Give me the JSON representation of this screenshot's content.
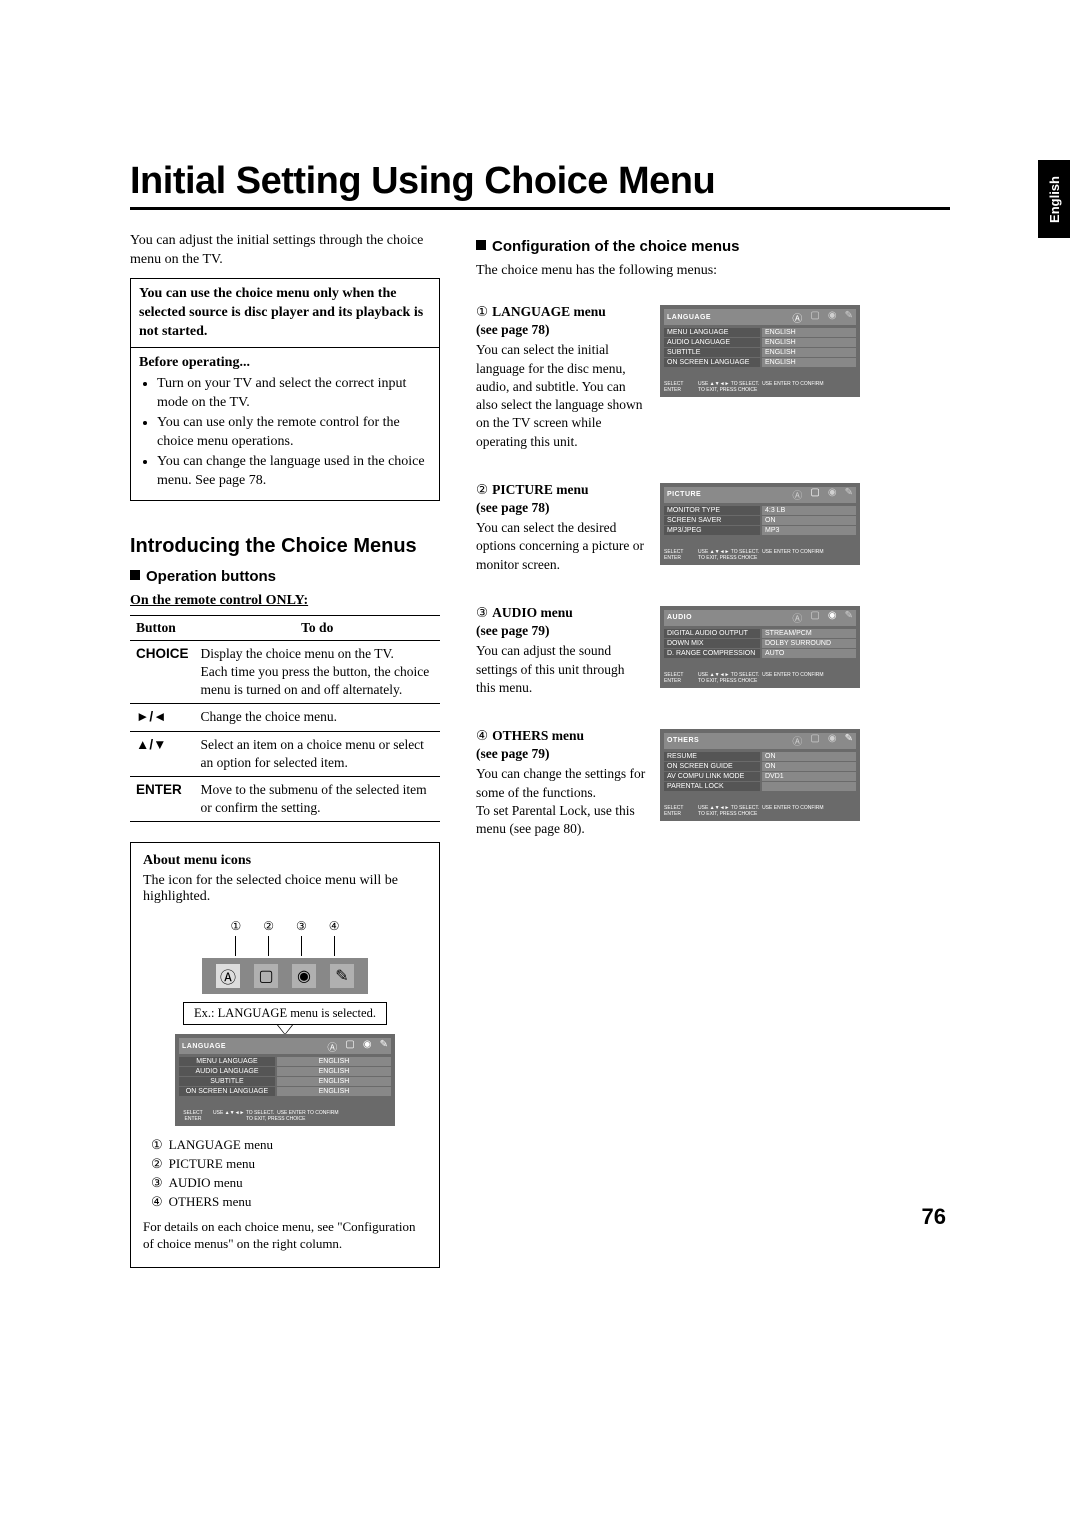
{
  "language_tab": "English",
  "title": "Initial Setting Using Choice Menu",
  "intro": "You can adjust the initial settings through the choice menu on the TV.",
  "note_box": "You can use the choice menu only when the selected source is disc player and its playback is not started.",
  "before_operating": {
    "heading": "Before operating...",
    "items": [
      "Turn on your TV and select the correct input mode on the TV.",
      "You can use only the remote control for the choice menu operations.",
      "You can change the language used in the choice menu. See page 78."
    ]
  },
  "intro_heading": "Introducing the Choice Menus",
  "operation_heading": "Operation buttons",
  "remote_only": "On the remote control ONLY:",
  "button_table": {
    "headers": [
      "Button",
      "To do"
    ],
    "rows": [
      {
        "btn": "CHOICE",
        "desc": "Display the choice menu on the TV.\nEach time you press the button, the choice menu is turned on and off alternately."
      },
      {
        "btn": "►/◄",
        "desc": "Change the choice menu."
      },
      {
        "btn": "▲/▼",
        "desc": "Select an item on a choice menu or select an option for selected item."
      },
      {
        "btn": "ENTER",
        "desc": "Move to the submenu of the selected item or confirm the setting."
      }
    ]
  },
  "about_icons": {
    "title": "About menu icons",
    "text": "The icon for the selected choice menu will be highlighted.",
    "example_label": "Ex.: LANGUAGE menu is selected.",
    "numbered_icons": [
      "①",
      "②",
      "③",
      "④"
    ],
    "menu_list": [
      {
        "num": "①",
        "label": "LANGUAGE menu"
      },
      {
        "num": "②",
        "label": "PICTURE menu"
      },
      {
        "num": "③",
        "label": "AUDIO menu"
      },
      {
        "num": "④",
        "label": "OTHERS menu"
      }
    ],
    "details_note": "For details on each choice menu, see \"Configuration of choice menus\" on the right column."
  },
  "config_heading": "Configuration of the choice menus",
  "config_intro": "The choice menu has the following menus:",
  "osd_footer": {
    "select": "SELECT",
    "enter": "ENTER",
    "instr1": "USE ▲▼◄► TO SELECT.",
    "instr2": "TO EXIT, PRESS CHOICE",
    "confirm": "USE ENTER TO CONFIRM"
  },
  "config_menus": [
    {
      "num": "①",
      "title": "LANGUAGE menu",
      "see": "(see page 78)",
      "desc": "You can select the initial language for the disc menu, audio, and subtitle. You can also select the language shown on the TV screen while operating this unit.",
      "osd_title": "LANGUAGE",
      "icons": [
        "Ⓐ",
        "▢",
        "◉",
        "✎"
      ],
      "rows": [
        {
          "k": "MENU LANGUAGE",
          "v": "ENGLISH"
        },
        {
          "k": "AUDIO LANGUAGE",
          "v": "ENGLISH"
        },
        {
          "k": "SUBTITLE",
          "v": "ENGLISH"
        },
        {
          "k": "ON SCREEN LANGUAGE",
          "v": "ENGLISH"
        }
      ]
    },
    {
      "num": "②",
      "title": "PICTURE menu",
      "see": "(see page 78)",
      "desc": "You can select the desired options concerning a picture or monitor screen.",
      "osd_title": "PICTURE",
      "icons": [
        "Ⓐ",
        "▢",
        "◉",
        "✎"
      ],
      "rows": [
        {
          "k": "MONITOR TYPE",
          "v": "4:3 LB"
        },
        {
          "k": "SCREEN SAVER",
          "v": "ON"
        },
        {
          "k": "MP3/JPEG",
          "v": "MP3"
        }
      ]
    },
    {
      "num": "③",
      "title": "AUDIO menu",
      "see": "(see page 79)",
      "desc": "You can adjust the sound settings of this unit through this menu.",
      "osd_title": "AUDIO",
      "icons": [
        "Ⓐ",
        "▢",
        "◉",
        "✎"
      ],
      "rows": [
        {
          "k": "DIGITAL AUDIO OUTPUT",
          "v": "STREAM/PCM"
        },
        {
          "k": "DOWN MIX",
          "v": "DOLBY SURROUND"
        },
        {
          "k": "D. RANGE COMPRESSION",
          "v": "AUTO"
        }
      ]
    },
    {
      "num": "④",
      "title": "OTHERS menu",
      "see": "(see page 79)",
      "desc": "You can change the settings for some of the functions.\nTo set Parental Lock, use this menu (see page 80).",
      "osd_title": "OTHERS",
      "icons": [
        "Ⓐ",
        "▢",
        "◉",
        "✎"
      ],
      "rows": [
        {
          "k": "RESUME",
          "v": "ON"
        },
        {
          "k": "ON SCREEN GUIDE",
          "v": "ON"
        },
        {
          "k": "AV COMPU LINK MODE",
          "v": "DVD1"
        },
        {
          "k": "PARENTAL LOCK",
          "v": ""
        }
      ]
    }
  ],
  "page_number": "76"
}
